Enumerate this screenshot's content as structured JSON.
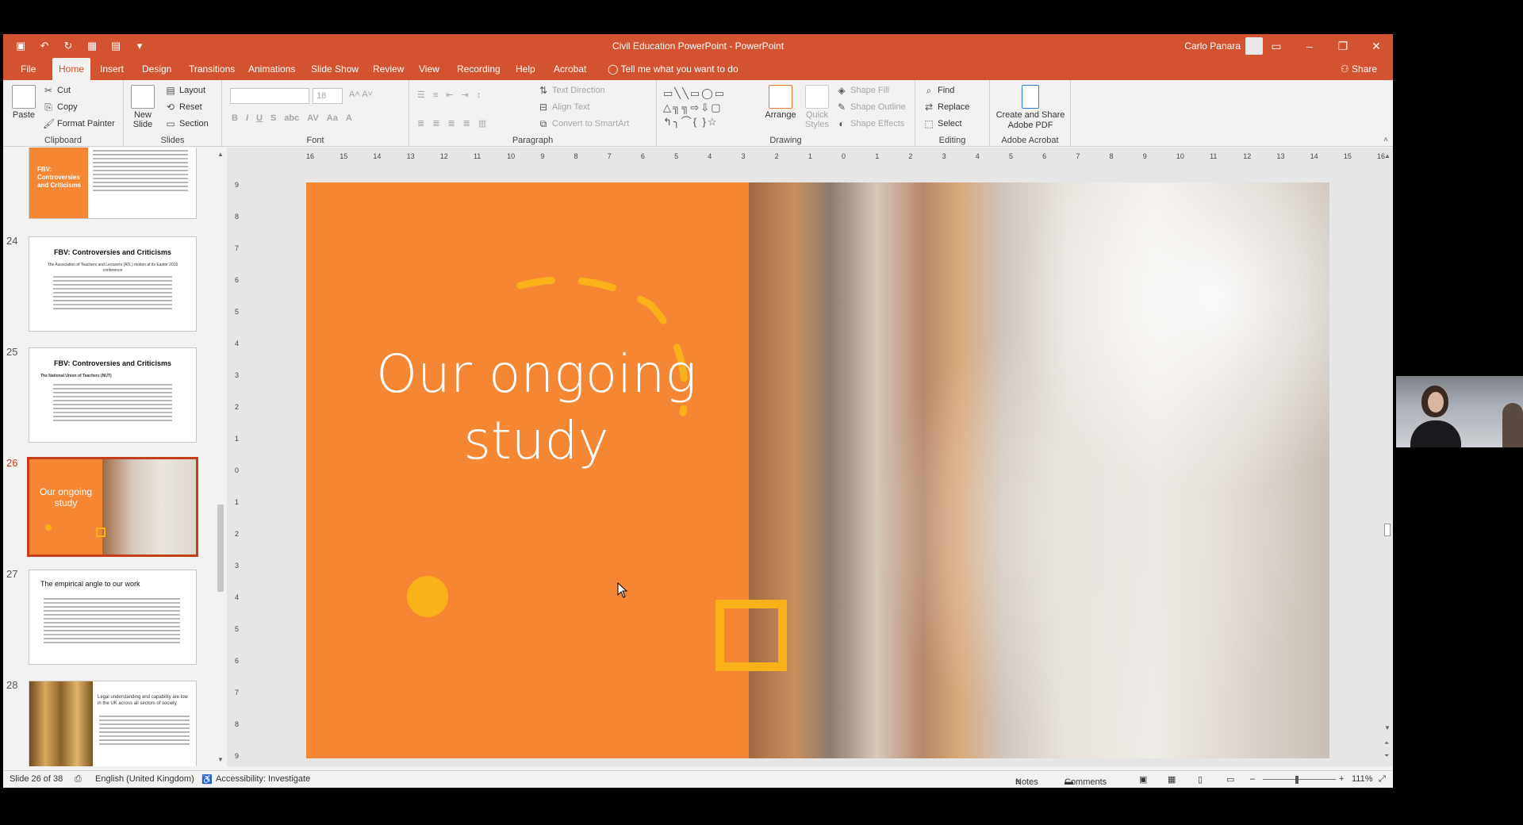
{
  "window": {
    "title": "Civil Education PowerPoint  -  PowerPoint",
    "user": "Carlo Panara",
    "share": "Share"
  },
  "tabs": [
    "File",
    "Home",
    "Insert",
    "Design",
    "Transitions",
    "Animations",
    "Slide Show",
    "Review",
    "View",
    "Recording",
    "Help",
    "Acrobat",
    "Tell me what you want to do"
  ],
  "ribbon": {
    "clipboard": {
      "label": "Clipboard",
      "paste": "Paste",
      "cut": "Cut",
      "copy": "Copy",
      "format_painter": "Format Painter"
    },
    "slides": {
      "label": "Slides",
      "new_slide": "New Slide",
      "layout": "Layout",
      "reset": "Reset",
      "section": "Section"
    },
    "font": {
      "label": "Font",
      "size": "18"
    },
    "paragraph": {
      "label": "Paragraph",
      "text_direction": "Text Direction",
      "align_text": "Align Text",
      "convert": "Convert to SmartArt"
    },
    "drawing": {
      "label": "Drawing",
      "arrange": "Arrange",
      "quick_styles": "Quick Styles",
      "shape_fill": "Shape Fill",
      "shape_outline": "Shape Outline",
      "shape_effects": "Shape Effects"
    },
    "editing": {
      "label": "Editing",
      "find": "Find",
      "replace": "Replace",
      "select": "Select"
    },
    "acrobat": {
      "label": "Adobe Acrobat",
      "create_share": "Create and Share Adobe PDF"
    }
  },
  "thumbnails": [
    {
      "number": "",
      "title": "FBV: Controversies and Criticisms"
    },
    {
      "number": "24",
      "title": "FBV: Controversies and Criticisms",
      "subtitle": "The Association of Teachers and Lecturers (ATL) motion at its Easter 2015 conference"
    },
    {
      "number": "25",
      "title": "FBV: Controversies and Criticisms",
      "subtitle": "The National Union of Teachers (NUT)"
    },
    {
      "number": "26",
      "title": "Our ongoing study"
    },
    {
      "number": "27",
      "title": "The empirical angle to our work"
    },
    {
      "number": "28",
      "title": "Legal understanding and capability are low in the UK across all sectors of society"
    }
  ],
  "slide": {
    "title_line1": "Our ongoing",
    "title_line2": "study",
    "accent_color": "#f58634",
    "shape_color": "#f9b11a"
  },
  "hruler_ticks": [
    "16",
    "15",
    "14",
    "13",
    "12",
    "11",
    "10",
    "9",
    "8",
    "7",
    "6",
    "5",
    "4",
    "3",
    "2",
    "1",
    "0",
    "1",
    "2",
    "3",
    "4",
    "5",
    "6",
    "7",
    "8",
    "9",
    "10",
    "11",
    "12",
    "13",
    "14",
    "15",
    "16"
  ],
  "vruler_ticks": [
    "9",
    "8",
    "7",
    "6",
    "5",
    "4",
    "3",
    "2",
    "1",
    "0",
    "1",
    "2",
    "3",
    "4",
    "5",
    "6",
    "7",
    "8",
    "9"
  ],
  "status": {
    "slide_info": "Slide 26 of 38",
    "language": "English (United Kingdom)",
    "accessibility": "Accessibility: Investigate",
    "notes": "Notes",
    "comments": "Comments",
    "zoom": "111%"
  }
}
